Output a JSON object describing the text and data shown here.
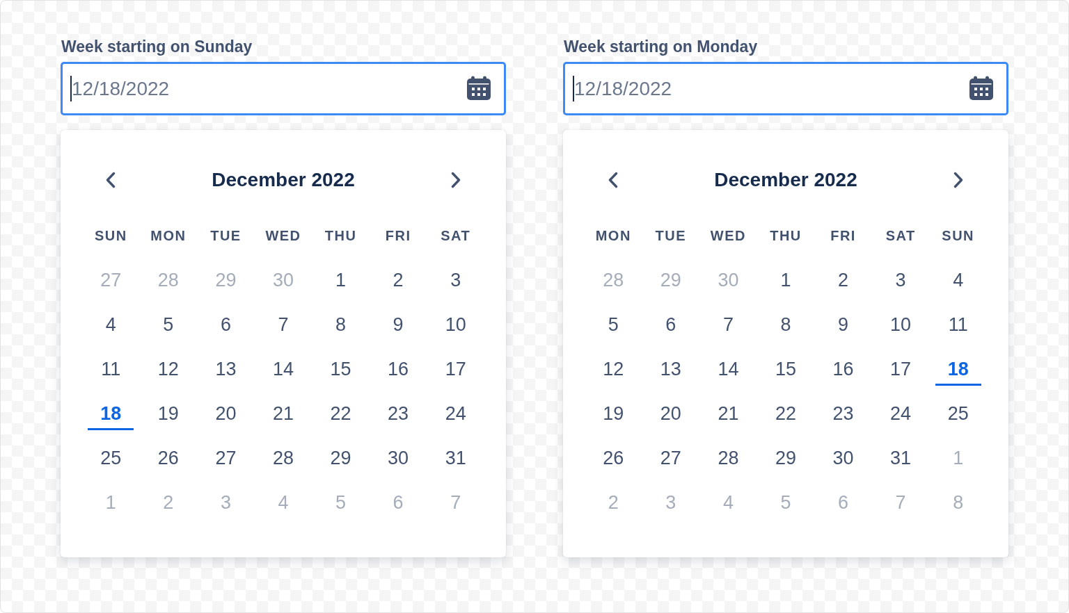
{
  "pickers": [
    {
      "label": "Week starting on Sunday",
      "input": {
        "value": "12/18/2022"
      },
      "calendar": {
        "title": "December 2022",
        "weekdays": [
          "SUN",
          "MON",
          "TUE",
          "WED",
          "THU",
          "FRI",
          "SAT"
        ],
        "days": [
          {
            "day": "27",
            "outside": true,
            "selected": false
          },
          {
            "day": "28",
            "outside": true,
            "selected": false
          },
          {
            "day": "29",
            "outside": true,
            "selected": false
          },
          {
            "day": "30",
            "outside": true,
            "selected": false
          },
          {
            "day": "1",
            "outside": false,
            "selected": false
          },
          {
            "day": "2",
            "outside": false,
            "selected": false
          },
          {
            "day": "3",
            "outside": false,
            "selected": false
          },
          {
            "day": "4",
            "outside": false,
            "selected": false
          },
          {
            "day": "5",
            "outside": false,
            "selected": false
          },
          {
            "day": "6",
            "outside": false,
            "selected": false
          },
          {
            "day": "7",
            "outside": false,
            "selected": false
          },
          {
            "day": "8",
            "outside": false,
            "selected": false
          },
          {
            "day": "9",
            "outside": false,
            "selected": false
          },
          {
            "day": "10",
            "outside": false,
            "selected": false
          },
          {
            "day": "11",
            "outside": false,
            "selected": false
          },
          {
            "day": "12",
            "outside": false,
            "selected": false
          },
          {
            "day": "13",
            "outside": false,
            "selected": false
          },
          {
            "day": "14",
            "outside": false,
            "selected": false
          },
          {
            "day": "15",
            "outside": false,
            "selected": false
          },
          {
            "day": "16",
            "outside": false,
            "selected": false
          },
          {
            "day": "17",
            "outside": false,
            "selected": false
          },
          {
            "day": "18",
            "outside": false,
            "selected": true
          },
          {
            "day": "19",
            "outside": false,
            "selected": false
          },
          {
            "day": "20",
            "outside": false,
            "selected": false
          },
          {
            "day": "21",
            "outside": false,
            "selected": false
          },
          {
            "day": "22",
            "outside": false,
            "selected": false
          },
          {
            "day": "23",
            "outside": false,
            "selected": false
          },
          {
            "day": "24",
            "outside": false,
            "selected": false
          },
          {
            "day": "25",
            "outside": false,
            "selected": false
          },
          {
            "day": "26",
            "outside": false,
            "selected": false
          },
          {
            "day": "27",
            "outside": false,
            "selected": false
          },
          {
            "day": "28",
            "outside": false,
            "selected": false
          },
          {
            "day": "29",
            "outside": false,
            "selected": false
          },
          {
            "day": "30",
            "outside": false,
            "selected": false
          },
          {
            "day": "31",
            "outside": false,
            "selected": false
          },
          {
            "day": "1",
            "outside": true,
            "selected": false
          },
          {
            "day": "2",
            "outside": true,
            "selected": false
          },
          {
            "day": "3",
            "outside": true,
            "selected": false
          },
          {
            "day": "4",
            "outside": true,
            "selected": false
          },
          {
            "day": "5",
            "outside": true,
            "selected": false
          },
          {
            "day": "6",
            "outside": true,
            "selected": false
          },
          {
            "day": "7",
            "outside": true,
            "selected": false
          }
        ]
      }
    },
    {
      "label": "Week starting on Monday",
      "input": {
        "value": "12/18/2022"
      },
      "calendar": {
        "title": "December 2022",
        "weekdays": [
          "MON",
          "TUE",
          "WED",
          "THU",
          "FRI",
          "SAT",
          "SUN"
        ],
        "days": [
          {
            "day": "28",
            "outside": true,
            "selected": false
          },
          {
            "day": "29",
            "outside": true,
            "selected": false
          },
          {
            "day": "30",
            "outside": true,
            "selected": false
          },
          {
            "day": "1",
            "outside": false,
            "selected": false
          },
          {
            "day": "2",
            "outside": false,
            "selected": false
          },
          {
            "day": "3",
            "outside": false,
            "selected": false
          },
          {
            "day": "4",
            "outside": false,
            "selected": false
          },
          {
            "day": "5",
            "outside": false,
            "selected": false
          },
          {
            "day": "6",
            "outside": false,
            "selected": false
          },
          {
            "day": "7",
            "outside": false,
            "selected": false
          },
          {
            "day": "8",
            "outside": false,
            "selected": false
          },
          {
            "day": "9",
            "outside": false,
            "selected": false
          },
          {
            "day": "10",
            "outside": false,
            "selected": false
          },
          {
            "day": "11",
            "outside": false,
            "selected": false
          },
          {
            "day": "12",
            "outside": false,
            "selected": false
          },
          {
            "day": "13",
            "outside": false,
            "selected": false
          },
          {
            "day": "14",
            "outside": false,
            "selected": false
          },
          {
            "day": "15",
            "outside": false,
            "selected": false
          },
          {
            "day": "16",
            "outside": false,
            "selected": false
          },
          {
            "day": "17",
            "outside": false,
            "selected": false
          },
          {
            "day": "18",
            "outside": false,
            "selected": true
          },
          {
            "day": "19",
            "outside": false,
            "selected": false
          },
          {
            "day": "20",
            "outside": false,
            "selected": false
          },
          {
            "day": "21",
            "outside": false,
            "selected": false
          },
          {
            "day": "22",
            "outside": false,
            "selected": false
          },
          {
            "day": "23",
            "outside": false,
            "selected": false
          },
          {
            "day": "24",
            "outside": false,
            "selected": false
          },
          {
            "day": "25",
            "outside": false,
            "selected": false
          },
          {
            "day": "26",
            "outside": false,
            "selected": false
          },
          {
            "day": "27",
            "outside": false,
            "selected": false
          },
          {
            "day": "28",
            "outside": false,
            "selected": false
          },
          {
            "day": "29",
            "outside": false,
            "selected": false
          },
          {
            "day": "30",
            "outside": false,
            "selected": false
          },
          {
            "day": "31",
            "outside": false,
            "selected": false
          },
          {
            "day": "1",
            "outside": true,
            "selected": false
          },
          {
            "day": "2",
            "outside": true,
            "selected": false
          },
          {
            "day": "3",
            "outside": true,
            "selected": false
          },
          {
            "day": "4",
            "outside": true,
            "selected": false
          },
          {
            "day": "5",
            "outside": true,
            "selected": false
          },
          {
            "day": "6",
            "outside": true,
            "selected": false
          },
          {
            "day": "7",
            "outside": true,
            "selected": false
          },
          {
            "day": "8",
            "outside": true,
            "selected": false
          }
        ]
      }
    }
  ]
}
